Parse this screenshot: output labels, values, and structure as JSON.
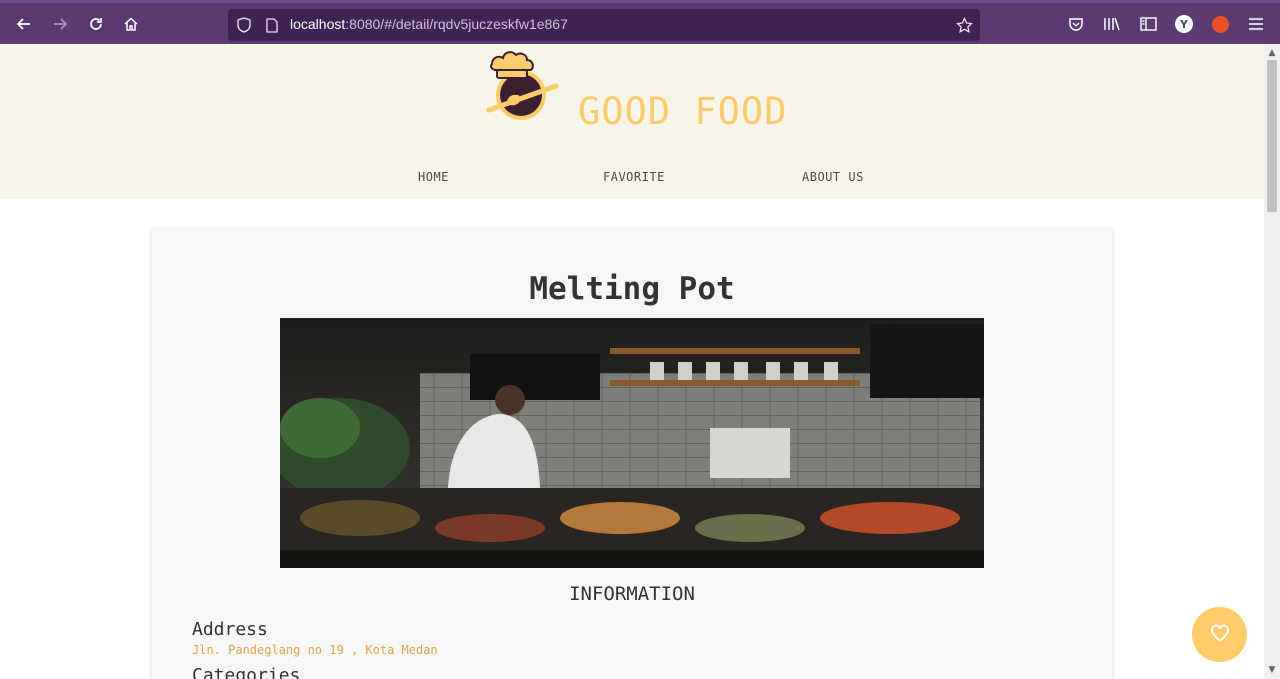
{
  "browser": {
    "url_host": "localhost",
    "url_path": ":8080/#/detail/rqdv5juczeskfw1e867",
    "profile_initial": "Y",
    "icons": [
      "back-arrow-icon",
      "forward-arrow-icon",
      "reload-icon",
      "home-icon",
      "shield-icon",
      "page-icon",
      "star-icon",
      "pocket-icon",
      "library-icon",
      "sidebar-icon",
      "profile-icon",
      "extension-icon",
      "menu-icon"
    ]
  },
  "site": {
    "brand": "GOOD FOOD",
    "nav": [
      "HOME",
      "FAVORITE",
      "ABOUT US"
    ]
  },
  "restaurant": {
    "name": "Melting Pot",
    "info_title": "INFORMATION",
    "address_label": "Address",
    "address": "Jln. Pandeglang no 19 , Kota Medan",
    "categories_label": "Categories"
  },
  "colors": {
    "accent": "#ffcb6b",
    "toolbar": "#5b3a72",
    "header_bg": "#f6f5e7"
  }
}
